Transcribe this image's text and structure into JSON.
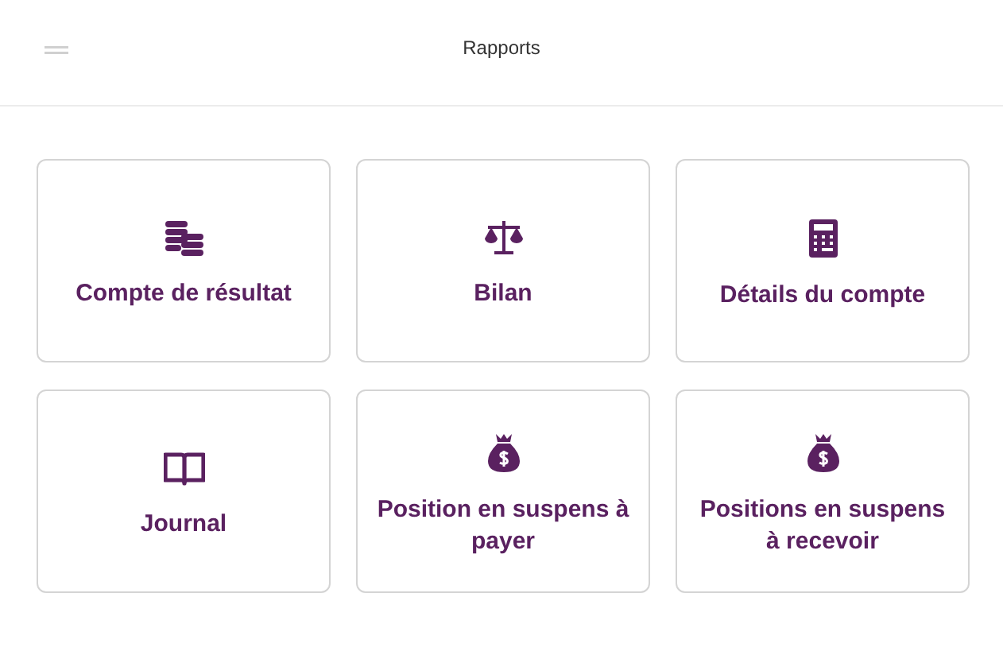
{
  "header": {
    "title": "Rapports"
  },
  "reports": [
    {
      "label": "Compte de résultat",
      "kind": "coins"
    },
    {
      "label": "Bilan",
      "kind": "scale"
    },
    {
      "label": "Détails du compte",
      "kind": "calculator"
    },
    {
      "label": "Journal",
      "kind": "book"
    },
    {
      "label": "Position en suspens à payer",
      "kind": "moneybag"
    },
    {
      "label": "Positions en suspens à recevoir",
      "kind": "moneybag"
    }
  ]
}
